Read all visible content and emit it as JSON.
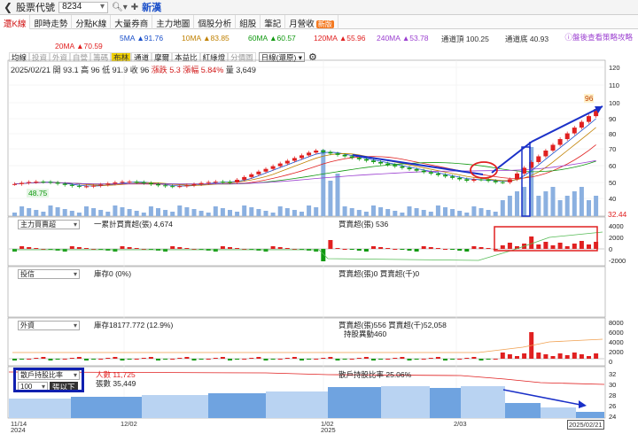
{
  "topbar": {
    "back_icon": "chevron-left-icon",
    "title": "股票代號",
    "code": "8234",
    "name": "新漢"
  },
  "tabs": [
    {
      "label": "還K線",
      "active": true
    },
    {
      "label": "即時走勢"
    },
    {
      "label": "分點K線"
    },
    {
      "label": "大量券商"
    },
    {
      "label": "主力地圖"
    },
    {
      "label": "個股分析"
    },
    {
      "label": "組股"
    },
    {
      "label": "筆記"
    },
    {
      "label": "月營收",
      "badge": "新版"
    }
  ],
  "ma": {
    "ma5": "5MA ▲91.76",
    "ma10": "10MA ▲83.85",
    "ma60": "60MA ▲60.57",
    "ma120": "120MA ▲55.96",
    "ma240": "240MA ▲53.78",
    "upper": "通道頂 100.25",
    "lower": "通道底 40.93",
    "ma20": "20MA ▲70.59"
  },
  "link_text": "盤後查看策略攻略",
  "subtabs": [
    "均線",
    "投資",
    "外資",
    "自營",
    "籌碼",
    "布林",
    "通道",
    "摩爾",
    "本益比",
    "紅綠燈",
    "分價圖"
  ],
  "period": "日線(還原)",
  "quote": {
    "date": "2025/02/21",
    "open": "開 93.1",
    "high": "高 96",
    "low": "低 91.9",
    "close": "收 96",
    "chg": "漲跌 5.3",
    "pct": "漲幅 5.84%",
    "vol": "量 3,649"
  },
  "main_labels": {
    "high_mark": "96",
    "low_mark": "48.75",
    "last_vol": "32.44"
  },
  "panel1": {
    "select": "主力買賣超",
    "legend1": "一累計買賣超(張) 4,674",
    "legend2": "買賣超(張) 536"
  },
  "panel2": {
    "select": "投信",
    "legend1": "庫存0 (0%)",
    "legend2": "買賣超(張)0 買賣超(千)0"
  },
  "panel3": {
    "select": "外資",
    "legend1": "庫存18177.772 (12.9%)",
    "legend2": "買賣超(張)556 買賣超(千)52,058",
    "legend3": "持股異動460"
  },
  "panel4": {
    "select": "散戶持股比率",
    "threshold": "100",
    "unit": "張以下",
    "legend1": "人數 11,725",
    "legend2": "張數 35,449",
    "legend3": "散戶持股比率 25.06%"
  },
  "xaxis": [
    {
      "label": "11/14",
      "sub": "2024"
    },
    {
      "label": "12/02",
      "sub": ""
    },
    {
      "label": "1/02",
      "sub": "2025"
    },
    {
      "label": "2/03",
      "sub": ""
    },
    {
      "label": "2025/02/21",
      "sub": ""
    }
  ],
  "yaxis_main": [
    "120",
    "110",
    "100",
    "90",
    "80",
    "70",
    "60",
    "50",
    "40"
  ],
  "yaxis_p1": [
    "4000",
    "2000",
    "0",
    "-2000"
  ],
  "yaxis_p3": [
    "8000",
    "6000",
    "4000",
    "2000",
    "0"
  ],
  "yaxis_p4": [
    "32",
    "30",
    "28",
    "26",
    "24"
  ],
  "colors": {
    "up": "#e02020",
    "down": "#119911",
    "accent": "#1a4fc9",
    "box": "#1020b0"
  }
}
